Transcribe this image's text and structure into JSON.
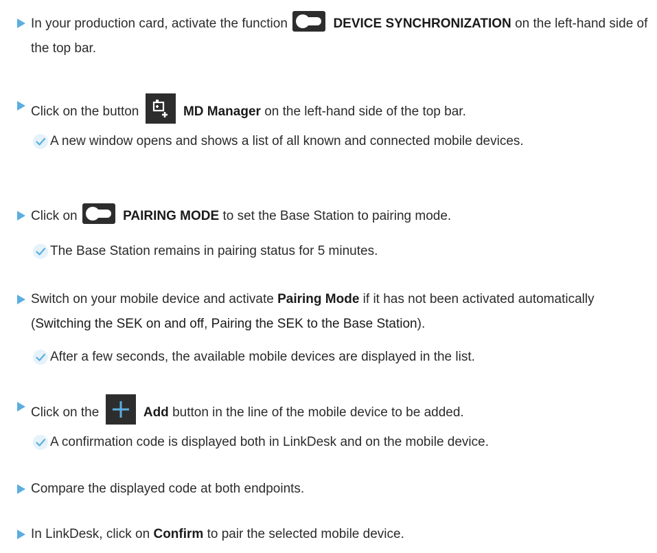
{
  "steps": [
    {
      "before": "In your production card, activate the function",
      "bold": "DEVICE SYNCHRONIZATION",
      "after": "on the left-hand side of the top bar.",
      "icon": "toggle-icon"
    },
    {
      "before": "Click on the button",
      "bold": "MD Manager",
      "after": "on the left-hand side of the top bar.",
      "icon": "md-manager-icon",
      "result": "A new window opens and shows a list of all known and connected mobile devices."
    },
    {
      "before": "Click on",
      "bold": "PAIRING MODE",
      "after": "to set the Base Station to pairing mode.",
      "icon": "toggle-icon",
      "result": "The Base Station remains in pairing status for 5 minutes."
    },
    {
      "before": "Switch on your mobile device and activate",
      "bold": "Pairing Mode",
      "after": "if it has not been activated automatically (",
      "link1": "Switching the SEK on and off",
      "separator": ",",
      "link2": "Pairing the SEK to the Base Station",
      "close": ").",
      "result": "After a few seconds, the available mobile devices are displayed in the list."
    },
    {
      "before": "Click on the",
      "bold": "Add",
      "after": "button in the line of the mobile device to be added.",
      "icon": "plus-icon",
      "result": "A confirmation code is displayed both in LinkDesk and on the mobile device."
    },
    {
      "text": "Compare the displayed code at both endpoints."
    },
    {
      "before": "In LinkDesk, click on",
      "bold": "Confirm",
      "after": "to pair the selected mobile device."
    }
  ],
  "colors": {
    "arrow": "#5aaee0",
    "check": "#5aaee0",
    "icon_bg": "#2d2d2d"
  }
}
